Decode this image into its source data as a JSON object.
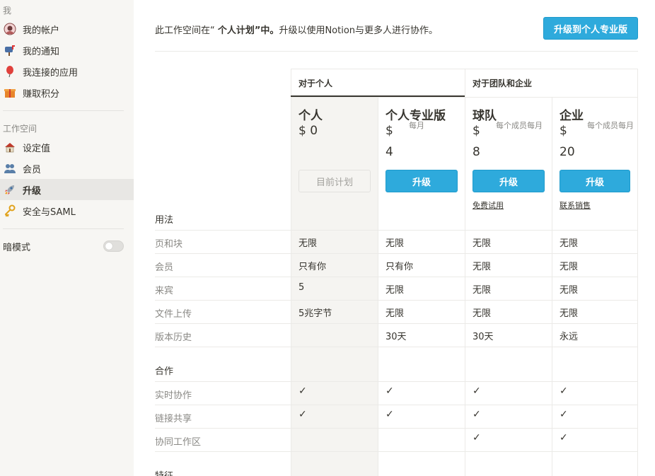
{
  "sidebar": {
    "section_me": "我",
    "items_me": [
      {
        "label": "我的帐户",
        "icon": "avatar-icon"
      },
      {
        "label": "我的通知",
        "icon": "mailbox-icon"
      },
      {
        "label": "我连接的应用",
        "icon": "balloon-icon"
      },
      {
        "label": "赚取积分",
        "icon": "gift-icon"
      }
    ],
    "section_workspace": "工作空间",
    "items_workspace": [
      {
        "label": "设定值",
        "icon": "house-icon"
      },
      {
        "label": "会员",
        "icon": "people-icon"
      },
      {
        "label": "升级",
        "icon": "rocket-icon",
        "active": true
      },
      {
        "label": "安全与SAML",
        "icon": "key-icon"
      }
    ],
    "dark_mode_label": "暗模式",
    "dark_mode_on": false
  },
  "notice": {
    "prefix": "此工作空间在“ ",
    "plan": "个人计划",
    "middle": "”中。",
    "suffix": "升级以使用Notion与更多人进行协作。"
  },
  "top_button": "升级到个人专业版",
  "groups": {
    "personal": "对于个人",
    "team": "对于团队和企业"
  },
  "plans": [
    {
      "name": "个人",
      "price_symbol": "$ 0",
      "price_note": "",
      "price_value": "",
      "button": "目前计划",
      "button_style": "ghost",
      "link": ""
    },
    {
      "name": "个人专业版",
      "price_symbol": "$",
      "price_note": "每月",
      "price_value": "4",
      "button": "升级",
      "button_style": "blue",
      "link": ""
    },
    {
      "name": "球队",
      "price_symbol": "$",
      "price_note": "每个成员每月",
      "price_value": "8",
      "button": "升级",
      "button_style": "blue",
      "link": "免费试用"
    },
    {
      "name": "企业",
      "price_symbol": "$",
      "price_note": "每个成员每月",
      "price_value": "20",
      "button": "升级",
      "button_style": "blue",
      "link": "联系销售"
    }
  ],
  "sections": {
    "usage": "用法",
    "collab": "合作",
    "features": "特征"
  },
  "usage_rows": [
    {
      "label": "页和块",
      "values": [
        "无限",
        "无限",
        "无限",
        "无限"
      ]
    },
    {
      "label": "会员",
      "values": [
        "只有你",
        "只有你",
        "无限",
        "无限"
      ]
    },
    {
      "label": "来宾",
      "values": [
        "5",
        "无限",
        "无限",
        "无限"
      ]
    },
    {
      "label": "文件上传",
      "values": [
        "5兆字节",
        "无限",
        "无限",
        "无限"
      ]
    },
    {
      "label": "版本历史",
      "values": [
        "",
        "30天",
        "30天",
        "永远"
      ]
    }
  ],
  "collab_rows": [
    {
      "label": "实时协作",
      "checks": [
        true,
        true,
        true,
        true
      ]
    },
    {
      "label": "链接共享",
      "checks": [
        true,
        true,
        true,
        true
      ]
    },
    {
      "label": "协同工作区",
      "checks": [
        false,
        false,
        true,
        true
      ]
    }
  ],
  "check_glyph": "✓",
  "colors": {
    "accent": "#2eaadc",
    "sidebar_bg": "#f7f6f3",
    "personal_col_bg": "#f5f4f1"
  }
}
